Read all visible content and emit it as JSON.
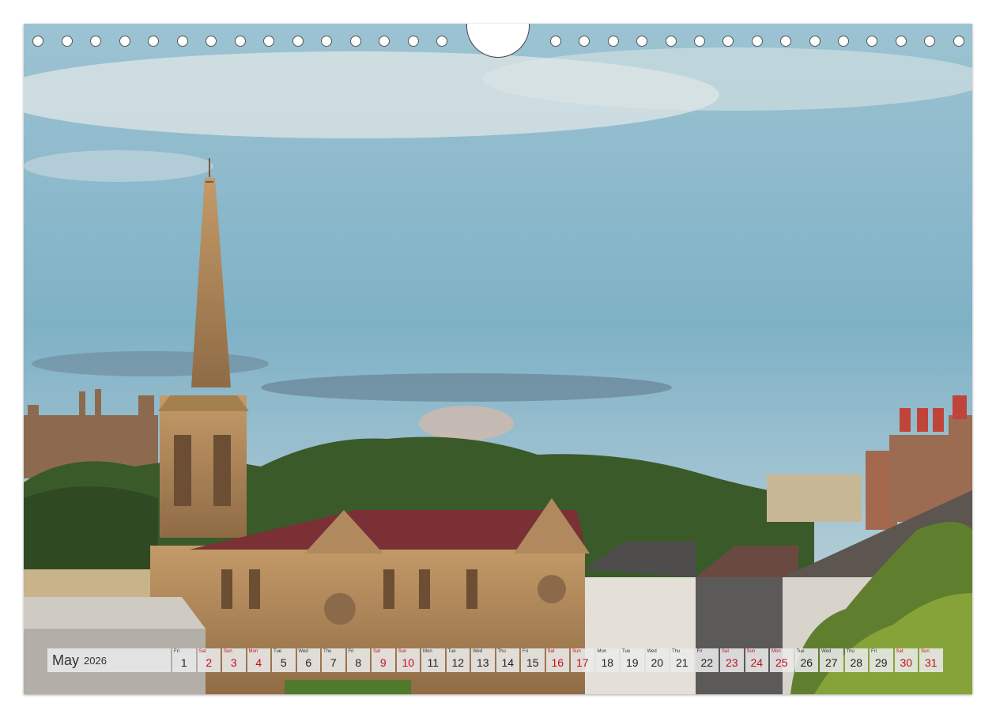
{
  "calendar": {
    "month": "May",
    "year": "2026",
    "weekend_color": "#c0101e",
    "days": [
      {
        "dow": "Fri",
        "num": "1",
        "weekend": false
      },
      {
        "dow": "Sat",
        "num": "2",
        "weekend": true
      },
      {
        "dow": "Sun",
        "num": "3",
        "weekend": true
      },
      {
        "dow": "Mon",
        "num": "4",
        "weekend": true
      },
      {
        "dow": "Tue",
        "num": "5",
        "weekend": false
      },
      {
        "dow": "Wed",
        "num": "6",
        "weekend": false
      },
      {
        "dow": "Thu",
        "num": "7",
        "weekend": false
      },
      {
        "dow": "Fri",
        "num": "8",
        "weekend": false
      },
      {
        "dow": "Sat",
        "num": "9",
        "weekend": true
      },
      {
        "dow": "Sun",
        "num": "10",
        "weekend": true
      },
      {
        "dow": "Mon",
        "num": "11",
        "weekend": false
      },
      {
        "dow": "Tue",
        "num": "12",
        "weekend": false
      },
      {
        "dow": "Wed",
        "num": "13",
        "weekend": false
      },
      {
        "dow": "Thu",
        "num": "14",
        "weekend": false
      },
      {
        "dow": "Fri",
        "num": "15",
        "weekend": false
      },
      {
        "dow": "Sat",
        "num": "16",
        "weekend": true
      },
      {
        "dow": "Sun",
        "num": "17",
        "weekend": true
      },
      {
        "dow": "Mon",
        "num": "18",
        "weekend": false
      },
      {
        "dow": "Tue",
        "num": "19",
        "weekend": false
      },
      {
        "dow": "Wed",
        "num": "20",
        "weekend": false
      },
      {
        "dow": "Thu",
        "num": "21",
        "weekend": false
      },
      {
        "dow": "Fri",
        "num": "22",
        "weekend": false
      },
      {
        "dow": "Sat",
        "num": "23",
        "weekend": true
      },
      {
        "dow": "Sun",
        "num": "24",
        "weekend": true
      },
      {
        "dow": "Mon",
        "num": "25",
        "weekend": true
      },
      {
        "dow": "Tue",
        "num": "26",
        "weekend": false
      },
      {
        "dow": "Wed",
        "num": "27",
        "weekend": false
      },
      {
        "dow": "Thu",
        "num": "28",
        "weekend": false
      },
      {
        "dow": "Fri",
        "num": "29",
        "weekend": false
      },
      {
        "dow": "Sat",
        "num": "30",
        "weekend": true
      },
      {
        "dow": "Sun",
        "num": "31",
        "weekend": true
      }
    ]
  },
  "binding": {
    "hole_count_left": 15,
    "hole_count_right": 15
  },
  "colors": {
    "sky_top": "#8fb8cc",
    "sky_bottom": "#a9c9d6",
    "stone": "#b08a5e",
    "roof": "#7a2f35",
    "trees": "#3c5a2c"
  }
}
